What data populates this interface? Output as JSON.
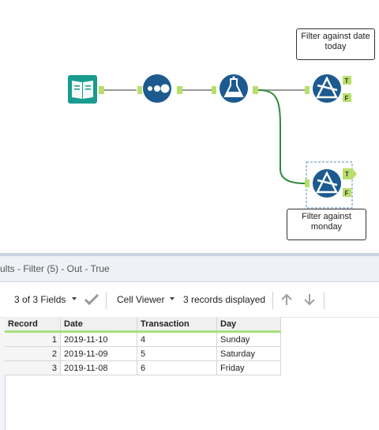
{
  "canvas": {
    "annotations": [
      {
        "text": "Filter against date today"
      },
      {
        "text": "Filter against monday"
      }
    ],
    "tools": [
      {
        "name": "input-data-tool",
        "icon": "book-icon",
        "color": "#1a9b8f"
      },
      {
        "name": "datetime-parse-tool",
        "icon": "dots-icon",
        "color": "#1c5a8f"
      },
      {
        "name": "formula-tool",
        "icon": "flask-icon",
        "color": "#1c5a8f"
      },
      {
        "name": "filter-tool",
        "icon": "filter-icon",
        "color": "#1c5a8f"
      },
      {
        "name": "filter-tool-selected",
        "icon": "filter-icon",
        "color": "#1c5a8f"
      }
    ],
    "anchor_labels": {
      "true": "T",
      "false": "F"
    }
  },
  "results": {
    "title": "ults - Filter (5) - Out - True",
    "fields_label": "3 of 3 Fields",
    "viewer_label": "Cell Viewer",
    "records_label": "3 records displayed"
  },
  "table": {
    "columns": [
      "Record",
      "Date",
      "Transaction",
      "Day"
    ],
    "rows": [
      [
        "1",
        "2019-11-10",
        "4",
        "Sunday"
      ],
      [
        "2",
        "2019-11-09",
        "5",
        "Saturday"
      ],
      [
        "3",
        "2019-11-08",
        "6",
        "Friday"
      ]
    ]
  },
  "colors": {
    "accent_green": "#a6e07e",
    "connector": "#999999",
    "selected_connector": "#2e8b3a",
    "tool_blue": "#1c5a8f",
    "tool_teal": "#1a9b8f"
  }
}
